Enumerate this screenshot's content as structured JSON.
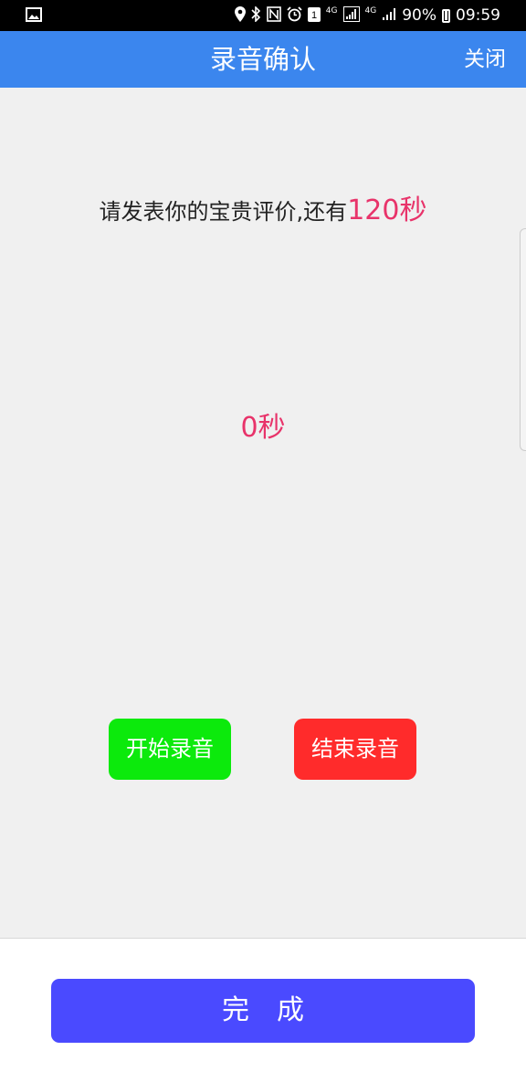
{
  "status_bar": {
    "battery": "90%",
    "time": "09:59",
    "network_1": "4G",
    "network_2": "4G",
    "icons": [
      "image-icon",
      "location-icon",
      "bluetooth-icon",
      "nfc-icon",
      "alarm-icon",
      "sim1-icon",
      "signal-icon",
      "signal-icon",
      "battery-icon"
    ]
  },
  "header": {
    "title": "录音确认",
    "close_label": "关闭",
    "color": "#3b86ee"
  },
  "main": {
    "prompt_text": "请发表你的宝贵评价,还有",
    "remaining": "120秒",
    "elapsed": "0秒",
    "start_label": "开始录音",
    "stop_label": "结束录音",
    "accent_color": "#e8336a"
  },
  "footer": {
    "done_label": "完成"
  }
}
